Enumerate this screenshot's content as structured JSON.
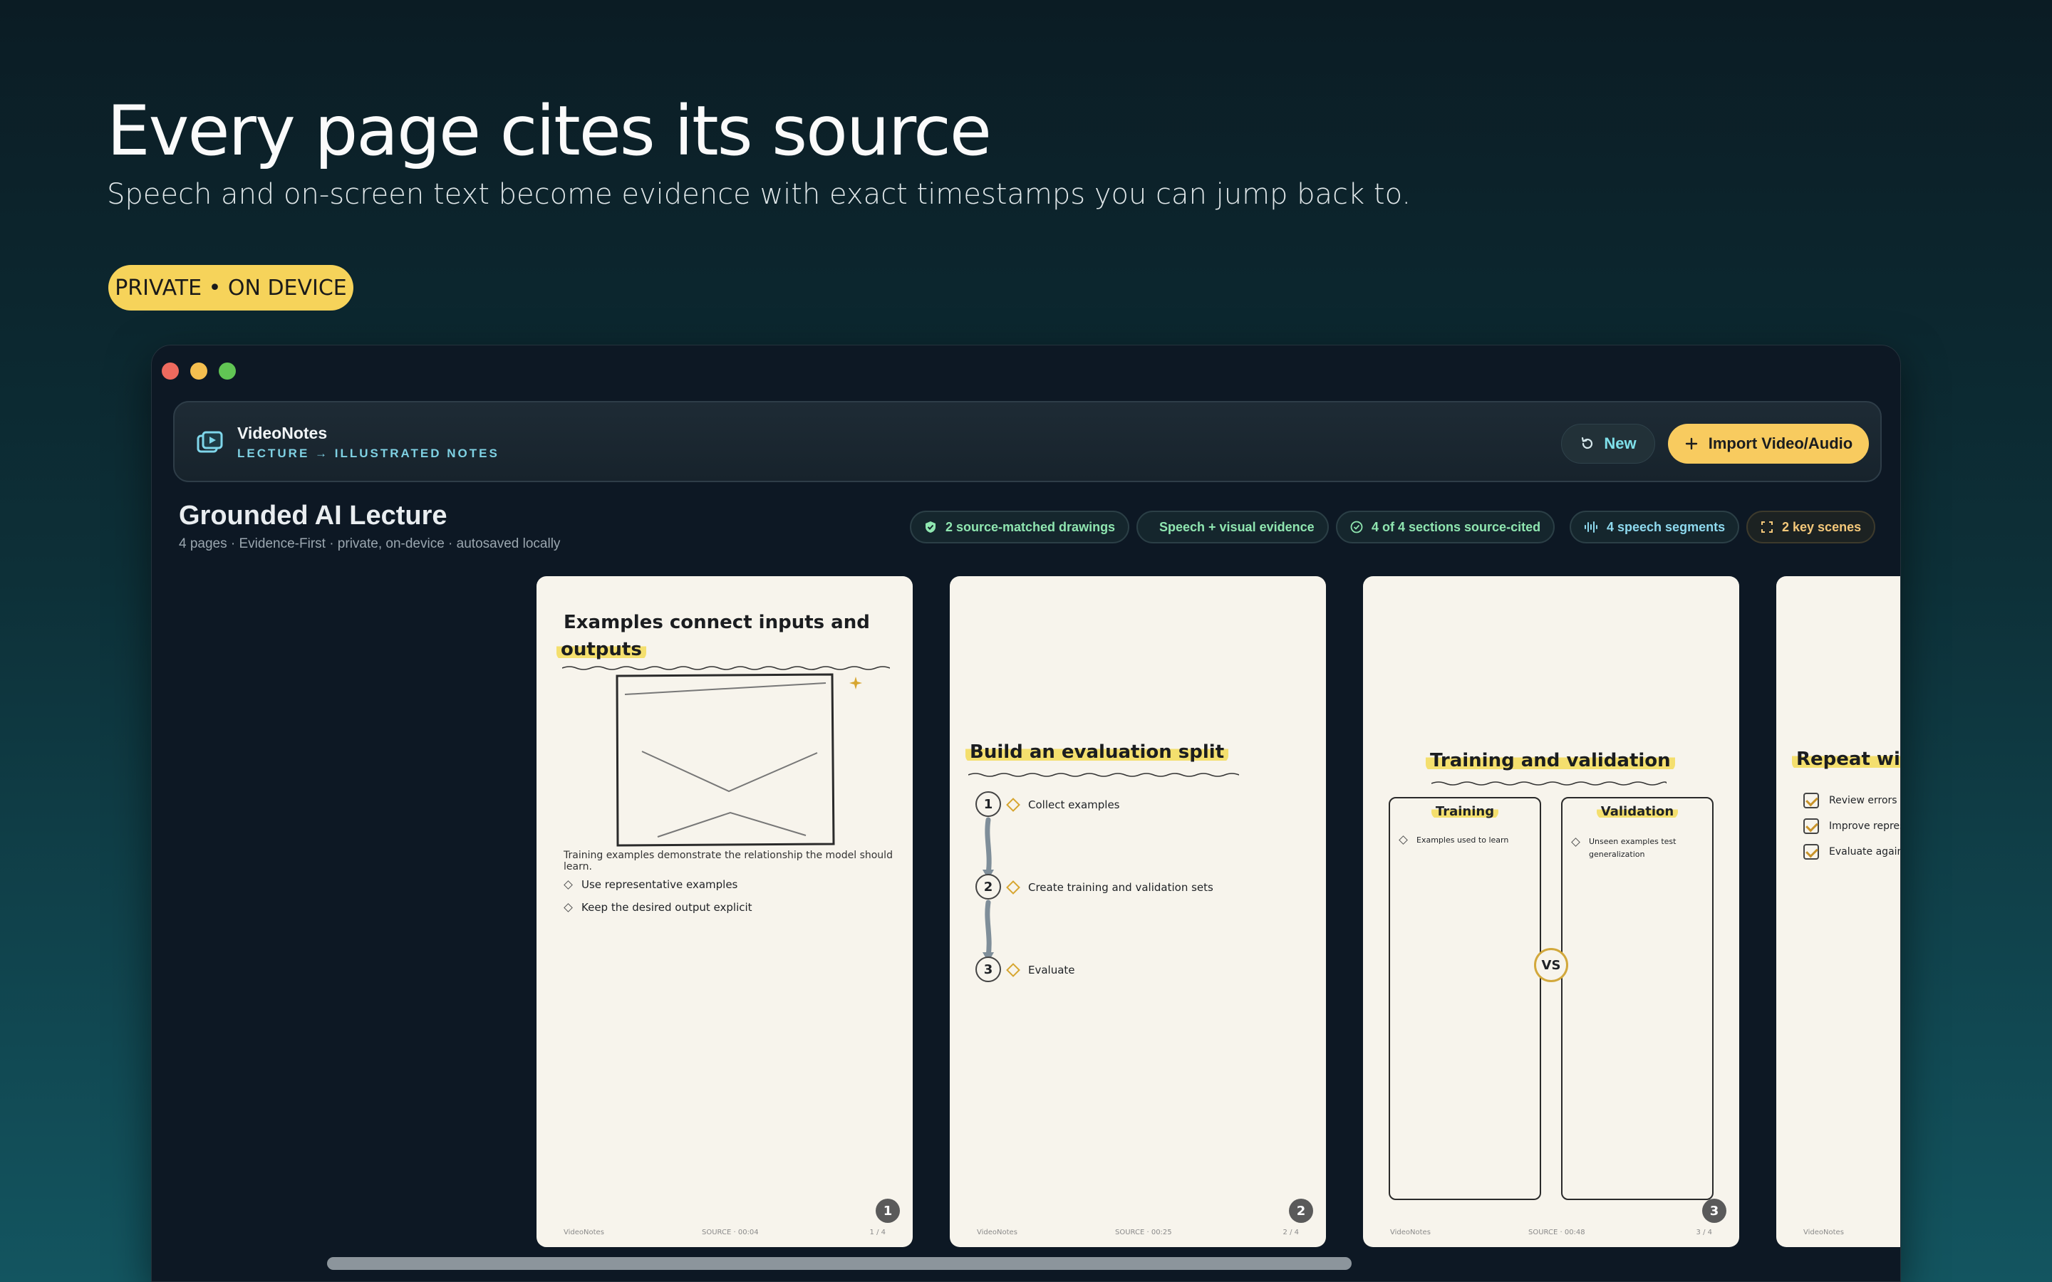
{
  "hero": {
    "title": "Every page cites its source",
    "subtitle": "Speech and on-screen text become evidence with exact timestamps you can jump back to.",
    "badge": "PRIVATE • ON DEVICE"
  },
  "app": {
    "name": "VideoNotes",
    "tagline": "LECTURE → ILLUSTRATED NOTES",
    "new_label": "New",
    "import_label": "Import Video/Audio"
  },
  "document": {
    "title": "Grounded AI Lecture",
    "meta": "4 pages · Evidence-First · private, on-device · autosaved locally"
  },
  "chips": [
    {
      "label": "2 source-matched drawings",
      "icon": "shield-check-icon"
    },
    {
      "label": "Speech + visual evidence",
      "icon": "none"
    },
    {
      "label": "4 of 4 sections source-cited",
      "icon": "check-circle-icon"
    },
    {
      "label": "4 speech segments",
      "icon": "waveform-icon"
    },
    {
      "label": "2 key scenes",
      "icon": "frame-corners-icon"
    }
  ],
  "pages": [
    {
      "title_line1": "Examples connect inputs and",
      "title_line2": "outputs",
      "caption": "Training examples demonstrate the relationship the model should learn.",
      "bullets": [
        "Use representative examples",
        "Keep the desired output explicit"
      ],
      "footer_brand": "VideoNotes",
      "footer_source": "SOURCE · 00:04",
      "footer_count": "1 / 4",
      "number": "1"
    },
    {
      "title": "Build an evaluation split",
      "steps": [
        {
          "num": "1",
          "label": "Collect examples"
        },
        {
          "num": "2",
          "label": "Create training and validation sets"
        },
        {
          "num": "3",
          "label": "Evaluate"
        }
      ],
      "footer_brand": "VideoNotes",
      "footer_source": "SOURCE · 00:25",
      "footer_count": "2 / 4",
      "number": "2"
    },
    {
      "title": "Training and validation",
      "left_title": "Training",
      "left_item": "Examples used to learn",
      "right_title": "Validation",
      "right_item": "Unseen examples test generalization",
      "vs": "VS",
      "footer_brand": "VideoNotes",
      "footer_source": "SOURCE · 00:48",
      "footer_count": "3 / 4",
      "number": "3"
    },
    {
      "title": "Repeat wi",
      "checks": [
        "Review errors",
        "Improve represe",
        "Evaluate again"
      ],
      "footer_brand": "VideoNotes"
    }
  ],
  "colors": {
    "accent_yellow": "#f8cb5f",
    "accent_cyan": "#7fd1e3",
    "chip_green": "#8fe6b0",
    "highlighter": "#f4df6e"
  }
}
